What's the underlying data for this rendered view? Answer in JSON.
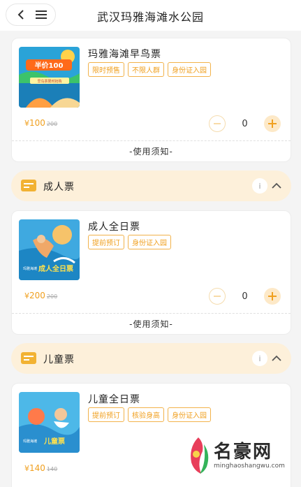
{
  "header": {
    "title": "武汉玛雅海滩水公园"
  },
  "icons": {
    "back": "chevron-left-icon",
    "menu": "hamburger-menu-icon",
    "info": "info-icon",
    "collapse": "chevron-up-icon",
    "category": "ticket-icon"
  },
  "colors": {
    "accent": "#f0a020",
    "category_bg": "#fdf0da",
    "tag_border": "#f2b24a"
  },
  "cards": [
    {
      "name": "玛雅海滩早鸟票",
      "tags": [
        "限时预售",
        "不限人群",
        "身份证入园"
      ],
      "image_text": [
        "半价100",
        "早鸟票限时抢购"
      ],
      "price": "100",
      "original_price": "200",
      "currency": "¥",
      "quantity": "0",
      "notice": "-使用须知-"
    },
    {
      "name": "成人全日票",
      "tags": [
        "提前预订",
        "身份证入园"
      ],
      "image_text": [
        "玛雅海滩",
        "成人全日票"
      ],
      "price": "200",
      "original_price": "200",
      "currency": "¥",
      "quantity": "0",
      "notice": "-使用须知-"
    },
    {
      "name": "儿童全日票",
      "tags": [
        "提前预订",
        "核验身高",
        "身份证入园"
      ],
      "image_text": [
        "玛雅海滩",
        "儿童票"
      ],
      "price": "140",
      "original_price": "140",
      "currency": "¥"
    }
  ],
  "categories": [
    {
      "label": "成人票",
      "info": "i"
    },
    {
      "label": "儿童票",
      "info": "i"
    }
  ],
  "watermark": {
    "text": "名豪网",
    "url": "minghaoshangwu.com"
  }
}
